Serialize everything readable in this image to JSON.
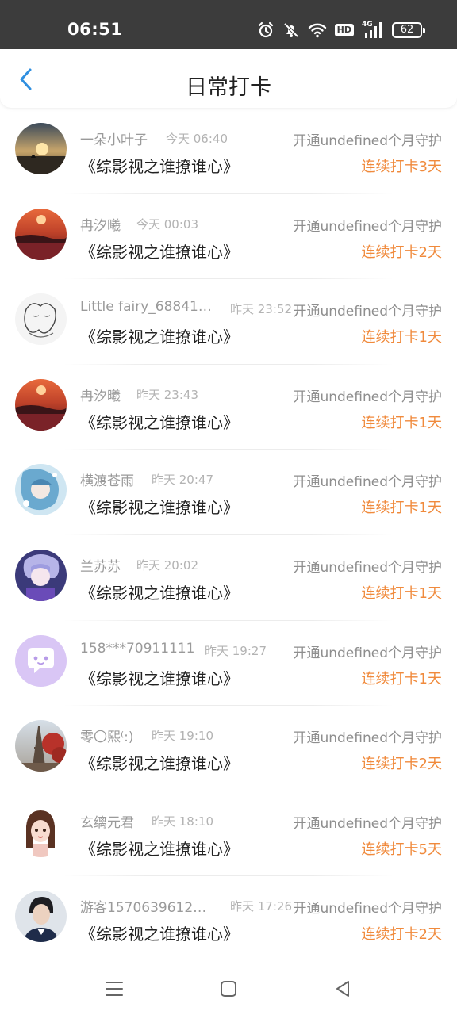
{
  "status_bar": {
    "time": "06:51",
    "icons": [
      "alarm-icon",
      "mute-bell-icon",
      "wifi-icon",
      "hd-icon",
      "signal-4g-icon",
      "battery-icon"
    ],
    "hd_label": "HD",
    "network_label": "4G",
    "battery_level": "62"
  },
  "header": {
    "back_icon": "chevron-left-icon",
    "title": "日常打卡"
  },
  "colors": {
    "accent_orange": "#f08a3c",
    "back_blue": "#2f8fe0",
    "status_bar_bg": "#3c3c3c"
  },
  "records": [
    {
      "avatar": "sunset-silhouette-avatar",
      "user": "一朵小叶子",
      "time": "今天 06:40",
      "book": "《综影视之谁撩谁心》",
      "guard": "开通undefined个月守护",
      "streak": "连续打卡3天"
    },
    {
      "avatar": "red-sunset-avatar",
      "user": "冉汐曦",
      "time": "今天 00:03",
      "book": "《综影视之谁撩谁心》",
      "guard": "开通undefined个月守护",
      "streak": "连续打卡2天"
    },
    {
      "avatar": "sketch-couple-avatar",
      "user": "Little fairy_688411...",
      "time": "昨天 23:52",
      "book": "《综影视之谁撩谁心》",
      "guard": "开通undefined个月守护",
      "streak": "连续打卡1天"
    },
    {
      "avatar": "red-sunset-avatar",
      "user": "冉汐曦",
      "time": "昨天 23:43",
      "book": "《综影视之谁撩谁心》",
      "guard": "开通undefined个月守护",
      "streak": "连续打卡1天"
    },
    {
      "avatar": "anime-blue-avatar",
      "user": "横渡苍雨",
      "time": "昨天 20:47",
      "book": "《综影视之谁撩谁心》",
      "guard": "开通undefined个月守护",
      "streak": "连续打卡1天"
    },
    {
      "avatar": "anime-purple-avatar",
      "user": "兰苏苏",
      "time": "昨天 20:02",
      "book": "《综影视之谁撩谁心》",
      "guard": "开通undefined个月守护",
      "streak": "连续打卡1天"
    },
    {
      "avatar": "default-chat-avatar",
      "user": "158***70911111",
      "time": "昨天 19:27",
      "book": "《综影视之谁撩谁心》",
      "guard": "开通undefined个月守护",
      "streak": "连续打卡1天"
    },
    {
      "avatar": "eiffel-tower-avatar",
      "user": "零〇熙⁽:)",
      "time": "昨天 19:10",
      "book": "《综影视之谁撩谁心》",
      "guard": "开通undefined个月守护",
      "streak": "连续打卡2天"
    },
    {
      "avatar": "cartoon-girl-avatar",
      "user": "玄缡元君",
      "time": "昨天 18:10",
      "book": "《综影视之谁撩谁心》",
      "guard": "开通undefined个月守护",
      "streak": "连续打卡5天"
    },
    {
      "avatar": "man-portrait-avatar",
      "user": "游客15706396121...",
      "time": "昨天 17:26",
      "book": "《综影视之谁撩谁心》",
      "guard": "开通undefined个月守护",
      "streak": "连续打卡2天"
    }
  ],
  "nav_bar": {
    "items": [
      "menu-icon",
      "home-square-icon",
      "back-triangle-icon"
    ]
  }
}
